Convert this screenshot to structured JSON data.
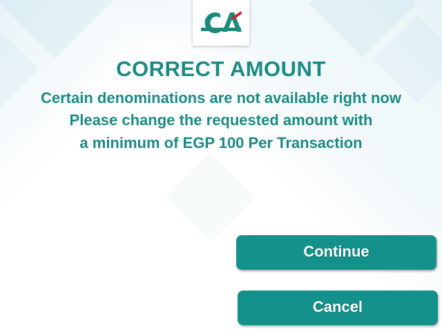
{
  "header": {
    "logo": {
      "icon": "credit-agricole-logo-icon",
      "colors": {
        "green": "#1b8a7a",
        "red": "#d8182a"
      }
    }
  },
  "main": {
    "title": "CORRECT AMOUNT",
    "message_lines": [
      "Certain denominations are not available right now",
      "Please change the requested amount with",
      "a minimum of EGP 100 Per Transaction"
    ]
  },
  "actions": {
    "continue_label": "Continue",
    "cancel_label": "Cancel"
  },
  "colors": {
    "accent": "#1b8a82",
    "button": "#14918a",
    "button_text": "#ffffff"
  }
}
